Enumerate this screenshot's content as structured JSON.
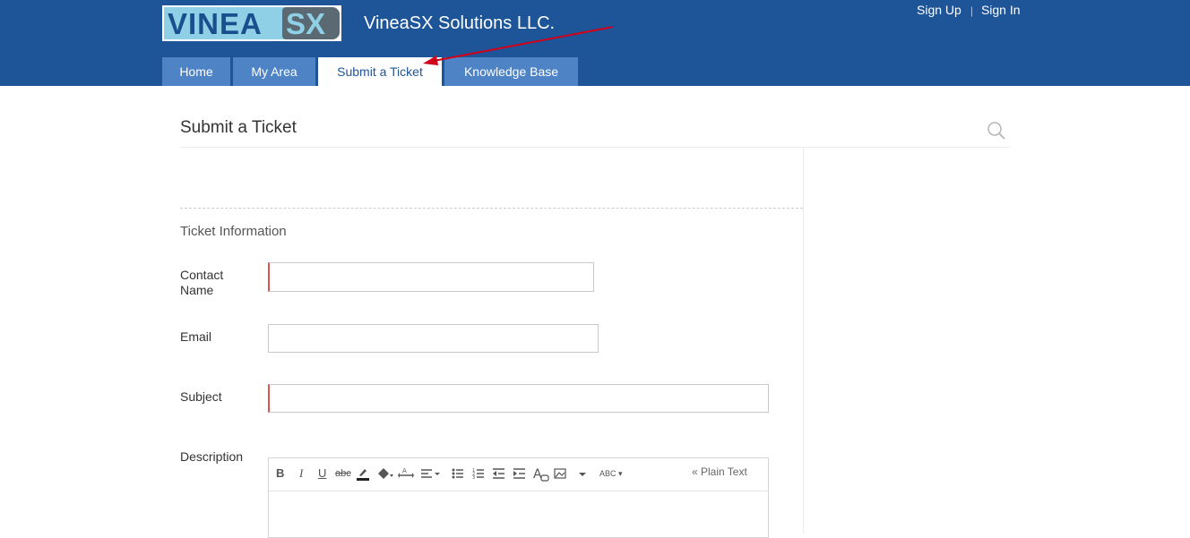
{
  "header": {
    "logo_left": "VINEA",
    "logo_right": "SX",
    "company": "VineaSX Solutions LLC.",
    "sign_up": "Sign Up",
    "separator": "|",
    "sign_in": "Sign In",
    "colors": {
      "bar": "#1e5598",
      "tab": "#4e83c6",
      "arrow": "#d0021b"
    }
  },
  "tabs": [
    {
      "label": "Home",
      "active": false
    },
    {
      "label": "My Area",
      "active": false
    },
    {
      "label": "Submit a Ticket",
      "active": true
    },
    {
      "label": "Knowledge Base",
      "active": false
    }
  ],
  "page": {
    "title": "Submit a Ticket",
    "search_icon": "search-icon",
    "section_title": "Ticket Information"
  },
  "form": {
    "contact_name": {
      "label": "Contact Name",
      "value": "",
      "required": true
    },
    "email": {
      "label": "Email",
      "value": "",
      "required": false
    },
    "subject": {
      "label": "Subject",
      "value": "",
      "required": true
    },
    "description": {
      "label": "Description",
      "value": ""
    }
  },
  "editor": {
    "bold": "B",
    "italic": "I",
    "underline": "U",
    "strike": "abc",
    "spell": "ABC",
    "plain_text": "« Plain Text",
    "icons": [
      "bold-icon",
      "italic-icon",
      "underline-icon",
      "strikethrough-icon",
      "font-color-icon",
      "background-color-icon",
      "text-direction-icon",
      "align-icon",
      "bullet-list-icon",
      "numbered-list-icon",
      "outdent-icon",
      "indent-icon",
      "clear-format-icon",
      "image-icon",
      "more-dropdown-icon",
      "spellcheck-icon"
    ]
  }
}
